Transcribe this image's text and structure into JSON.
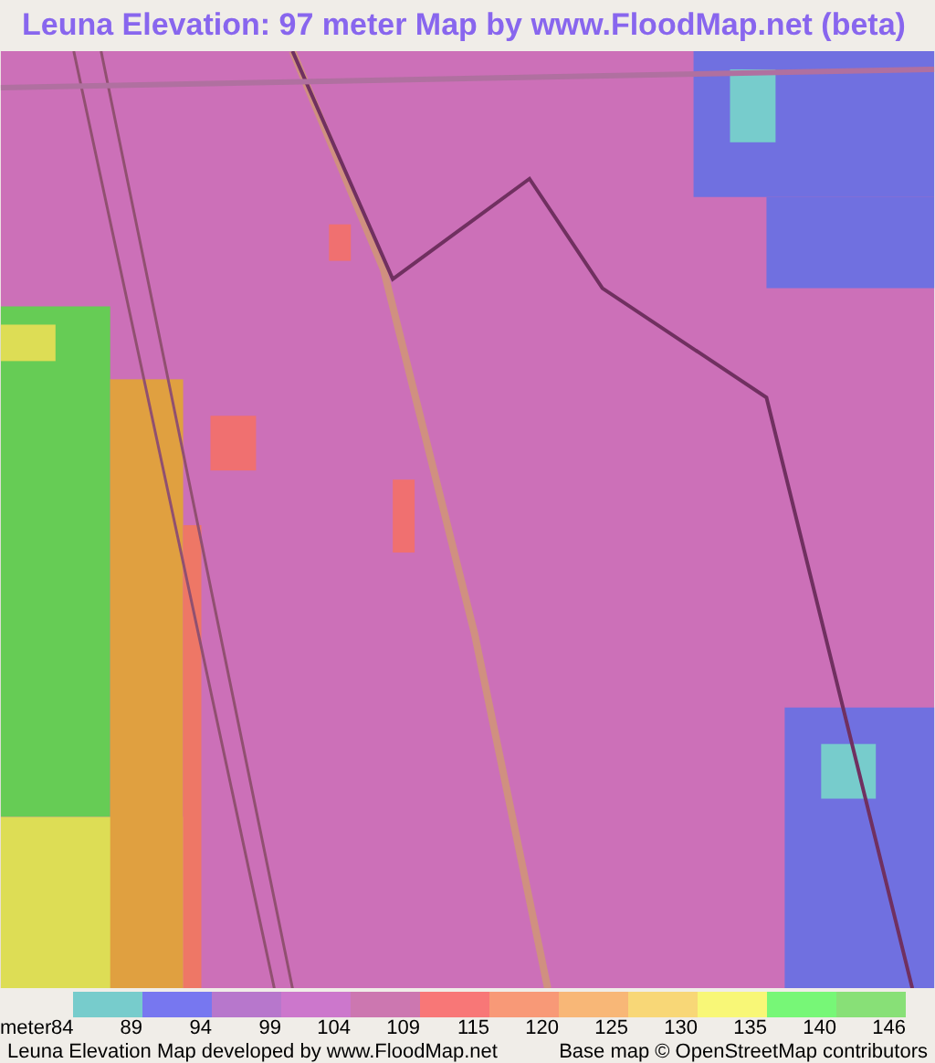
{
  "title": "Leuna Elevation: 97 meter Map by www.FloodMap.net (beta)",
  "legend": {
    "unit": "meter",
    "swatches": [
      {
        "color": "#77cccc"
      },
      {
        "color": "#7777f0"
      },
      {
        "color": "#b777cc"
      },
      {
        "color": "#cc77cc"
      },
      {
        "color": "#cc77b0"
      },
      {
        "color": "#f87777"
      },
      {
        "color": "#f89977"
      },
      {
        "color": "#f8b777"
      },
      {
        "color": "#f8d777"
      },
      {
        "color": "#f8f777"
      },
      {
        "color": "#77f777"
      },
      {
        "color": "#88e077"
      }
    ],
    "labels": [
      "84",
      "89",
      "94",
      "99",
      "104",
      "109",
      "115",
      "120",
      "125",
      "130",
      "135",
      "140",
      "146"
    ]
  },
  "footer": {
    "left": "Leuna Elevation Map developed by www.FloodMap.net",
    "right": "Base map © OpenStreetMap contributors"
  }
}
